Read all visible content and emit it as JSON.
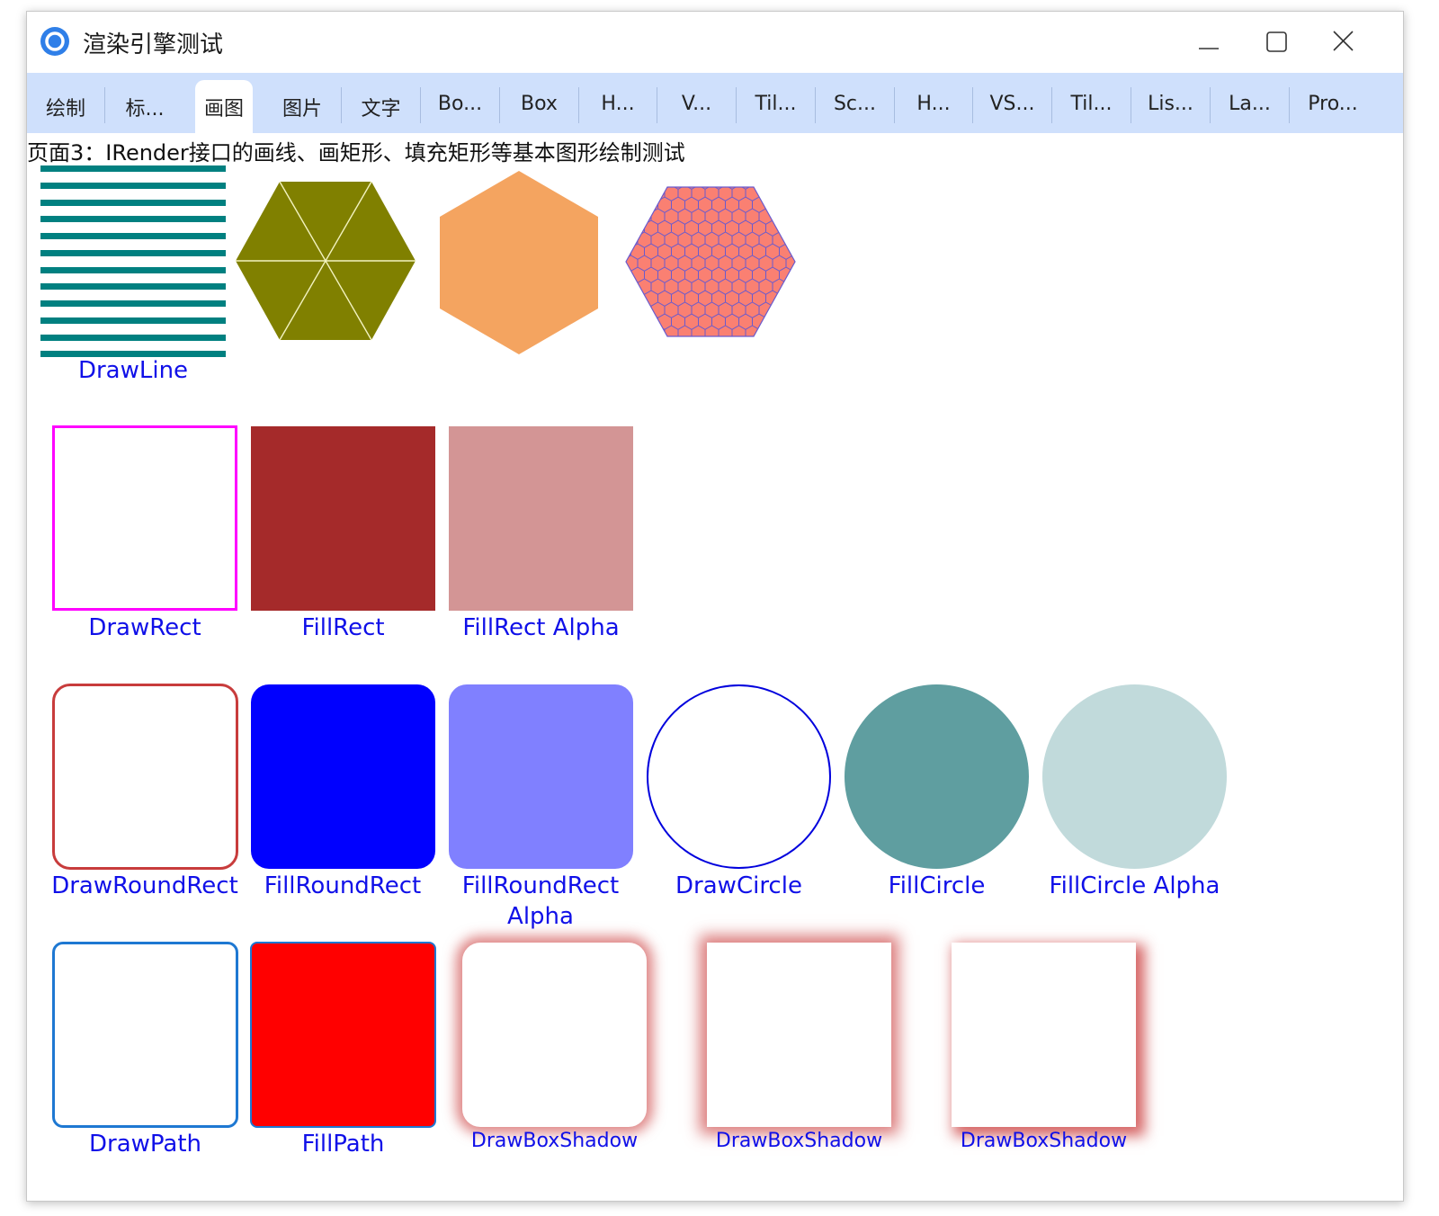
{
  "window": {
    "title": "渲染引擎测试",
    "app_icon": "app-logo-icon",
    "controls": [
      "minimize-icon",
      "maximize-icon",
      "close-icon"
    ]
  },
  "tabs": [
    {
      "label": "绘制",
      "active": false
    },
    {
      "label": "标...",
      "active": false
    },
    {
      "label": "画图",
      "active": true
    },
    {
      "label": "图片",
      "active": false
    },
    {
      "label": "文字",
      "active": false
    },
    {
      "label": "Bo...",
      "active": false
    },
    {
      "label": "Box",
      "active": false
    },
    {
      "label": "H...",
      "active": false
    },
    {
      "label": "V...",
      "active": false
    },
    {
      "label": "Til...",
      "active": false
    },
    {
      "label": "Sc...",
      "active": false
    },
    {
      "label": "H...",
      "active": false
    },
    {
      "label": "VS...",
      "active": false
    },
    {
      "label": "Til...",
      "active": false
    },
    {
      "label": "Lis...",
      "active": false
    },
    {
      "label": "La...",
      "active": false
    },
    {
      "label": "Pro...",
      "active": false
    }
  ],
  "page": {
    "description": "页面3：IRender接口的画线、画矩形、填充矩形等基本图形绘制测试"
  },
  "labels": {
    "draw_line": "DrawLine",
    "draw_rect": "DrawRect",
    "fill_rect": "FillRect",
    "fill_rect_alpha": "FillRect Alpha",
    "draw_round_rect": "DrawRoundRect",
    "fill_round_rect": "FillRoundRect",
    "fill_round_rect_alpha_1": "FillRoundRect",
    "fill_round_rect_alpha_2": "Alpha",
    "draw_circle": "DrawCircle",
    "fill_circle": "FillCircle",
    "fill_circle_alpha": "FillCircle Alpha",
    "draw_path": "DrawPath",
    "fill_path": "FillPath",
    "draw_box_shadow_1": "DrawBoxShadow",
    "draw_box_shadow_2": "DrawBoxShadow",
    "draw_box_shadow_3": "DrawBoxShadow"
  },
  "colors": {
    "accent_label": "#1010e8",
    "tab_bar": "#cfe0fc",
    "draw_line": "#008080",
    "olive_hexagon": "#808000",
    "orange_hexagon": "#f4a460",
    "honeycomb_fill": "#fa8072",
    "honeycomb_stroke": "#6a5acd",
    "draw_rect_border": "#ff00ff",
    "fill_rect": "#a52a2a",
    "fill_rect_alpha": "#d39595",
    "draw_round_rect_border": "#c83c3c",
    "fill_round_rect": "#0000ff",
    "fill_round_rect_alpha": "#8080ff",
    "draw_circle_border": "#0000dd",
    "fill_circle": "#5f9ea0",
    "fill_circle_alpha": "#c1dadb",
    "draw_path_border": "#1e78d2",
    "fill_path": "#ff0000",
    "box_shadow": "#c83232"
  }
}
